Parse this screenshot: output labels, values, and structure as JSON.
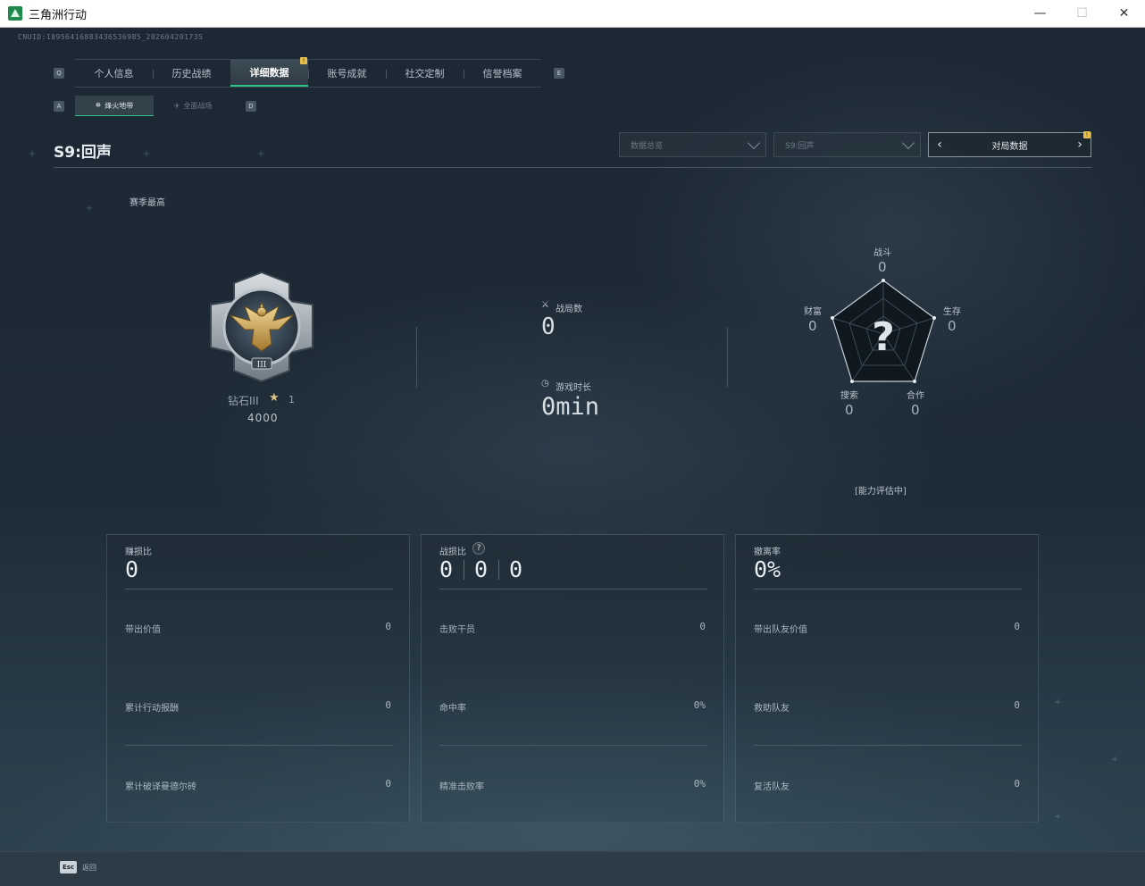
{
  "window": {
    "title": "三角洲行动",
    "minimize": "—",
    "maximize": "☐",
    "close": "✕"
  },
  "cnuid": "CNUID:18956416883436536985_202604201735",
  "main_tabs": {
    "left_key": "Q",
    "right_key": "E",
    "items": [
      {
        "label": "个人信息"
      },
      {
        "label": "历史战绩"
      },
      {
        "label": "详细数据",
        "active": true
      },
      {
        "label": "账号成就"
      },
      {
        "label": "社交定制"
      },
      {
        "label": "信誉档案"
      }
    ],
    "badge": "!"
  },
  "sub_tabs": {
    "left_key": "A",
    "right_key": "D",
    "items": [
      {
        "label": "烽火地带",
        "active": true
      },
      {
        "label": "全面战场"
      }
    ]
  },
  "season": {
    "title": "S9:回声",
    "dropdown_mode": "数据总览",
    "dropdown_season": "S9:回声",
    "pager_label": "对局数据",
    "pager_badge": "!"
  },
  "season_best": {
    "label": "赛季最高",
    "rank_name": "钻石III",
    "stars": "1",
    "score": "4000"
  },
  "summary": {
    "matches_label": "战局数",
    "matches_value": "0",
    "playtime_label": "游戏时长",
    "playtime_value": "0min"
  },
  "radar": {
    "center_mark": "?",
    "combat": {
      "label": "战斗",
      "value": "0"
    },
    "survival": {
      "label": "生存",
      "value": "0"
    },
    "teamwork": {
      "label": "合作",
      "value": "0"
    },
    "search": {
      "label": "搜索",
      "value": "0"
    },
    "wealth": {
      "label": "财富",
      "value": "0"
    },
    "assess_text": "[能力评估中]"
  },
  "cards": [
    {
      "title": "赚损比",
      "big": "0",
      "rows": [
        {
          "label": "带出价值",
          "value": "0"
        },
        {
          "label": "累计行动报酬",
          "value": "0"
        },
        {
          "label": "累计破译曼德尔砖",
          "value": "0"
        }
      ]
    },
    {
      "title": "战损比",
      "help": "?",
      "big_parts": [
        "0",
        "0",
        "0"
      ],
      "rows": [
        {
          "label": "击败干员",
          "value": "0"
        },
        {
          "label": "命中率",
          "value": "0%"
        },
        {
          "label": "精准击败率",
          "value": "0%"
        }
      ]
    },
    {
      "title": "撤离率",
      "big": "0%",
      "rows": [
        {
          "label": "带出队友价值",
          "value": "0"
        },
        {
          "label": "救助队友",
          "value": "0"
        },
        {
          "label": "复活队友",
          "value": "0"
        }
      ]
    }
  ],
  "bottom": {
    "esc_key": "Esc",
    "esc_label": "返回"
  }
}
